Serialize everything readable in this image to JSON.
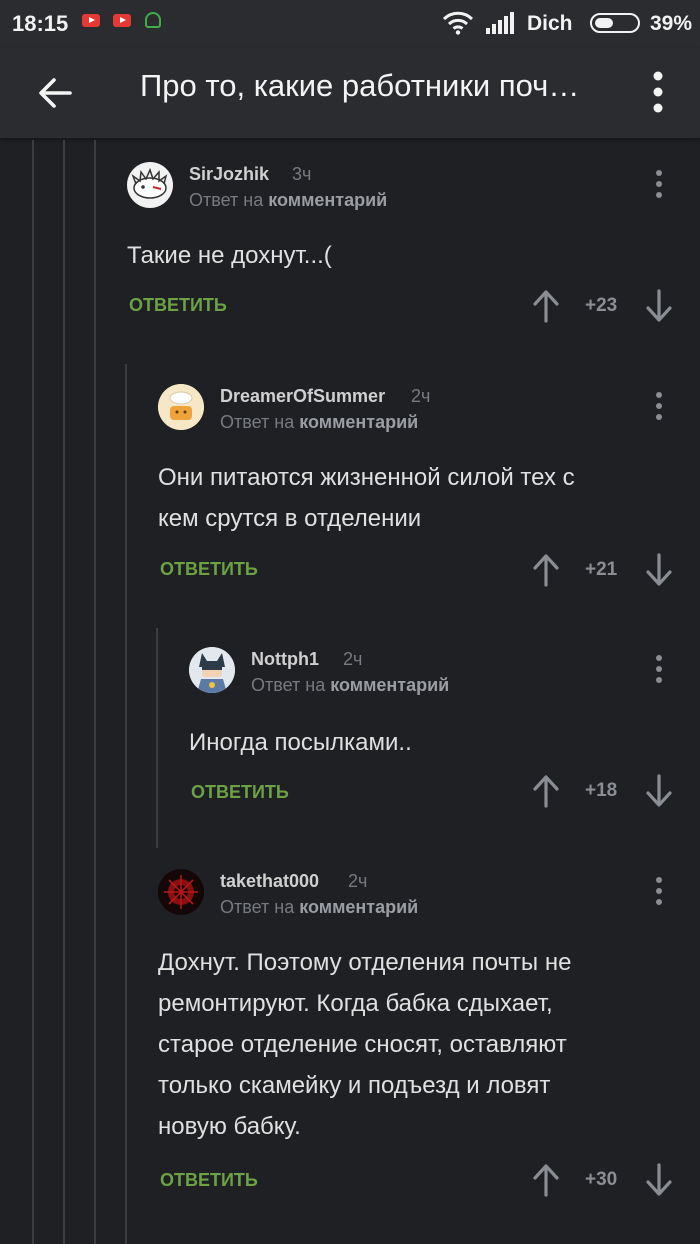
{
  "status_bar": {
    "time": "18:15",
    "carrier": "Dich",
    "battery": "39%",
    "notification_icons": [
      "youtube-icon",
      "youtube-icon",
      "android-icon"
    ]
  },
  "header": {
    "title": "Про то, какие работники поч…"
  },
  "comments": [
    {
      "username": "SirJozhik",
      "time": "3ч",
      "reply_prefix": "Ответ на",
      "reply_target": "комментарий",
      "text_lines": [
        "Такие не дохнут...("
      ],
      "answer_label": "ОТВЕТИТЬ",
      "score": "+23"
    },
    {
      "username": "DreamerOfSummer",
      "time": "2ч",
      "reply_prefix": "Ответ на",
      "reply_target": "комментарий",
      "text_lines": [
        "Они питаются жизненной силой тех с",
        "кем срутся в отделении"
      ],
      "answer_label": "ОТВЕТИТЬ",
      "score": "+21"
    },
    {
      "username": "Nottph1",
      "time": "2ч",
      "reply_prefix": "Ответ на",
      "reply_target": "комментарий",
      "text_lines": [
        "Иногда посылками.."
      ],
      "answer_label": "ОТВЕТИТЬ",
      "score": "+18"
    },
    {
      "username": "takethat000",
      "time": "2ч",
      "reply_prefix": "Ответ на",
      "reply_target": "комментарий",
      "text_lines": [
        "Дохнут. Поэтому отделения почты не",
        "ремонтируют. Когда бабка сдыхает,",
        "старое отделение сносят, оставляют",
        "только скамейку и подъезд и ловят",
        "новую бабку."
      ],
      "answer_label": "ОТВЕТИТЬ",
      "score": "+30"
    }
  ],
  "colors": {
    "background": "#1f2023",
    "header": "#2a2c30",
    "answer_green": "#6ca244",
    "muted": "#777a80"
  }
}
